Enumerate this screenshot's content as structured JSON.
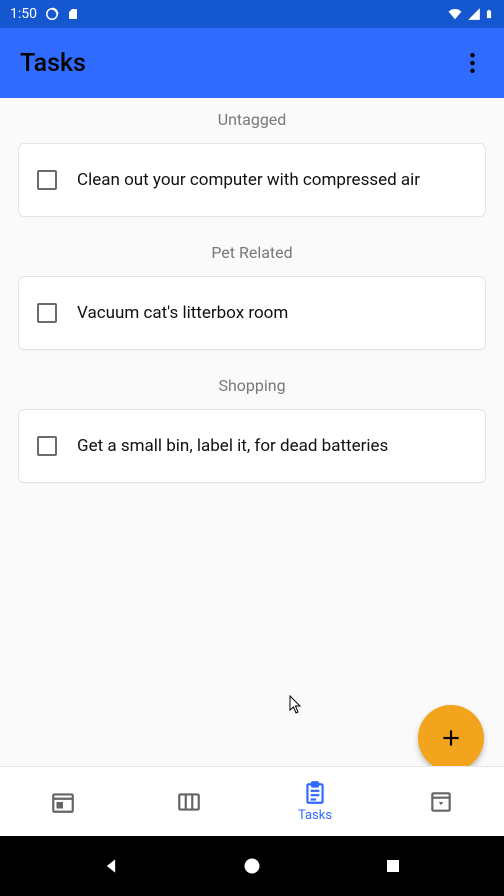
{
  "status": {
    "time": "1:50"
  },
  "app_bar": {
    "title": "Tasks"
  },
  "sections": [
    {
      "header": "Untagged",
      "tasks": [
        {
          "text": "Clean out your computer with compressed air",
          "checked": false
        }
      ]
    },
    {
      "header": "Pet Related",
      "tasks": [
        {
          "text": "Vacuum cat's litterbox room",
          "checked": false
        }
      ]
    },
    {
      "header": "Shopping",
      "tasks": [
        {
          "text": "Get a small bin, label it, for dead batteries",
          "checked": false
        }
      ]
    }
  ],
  "bottom_nav": {
    "items": [
      {
        "label": "",
        "active": false
      },
      {
        "label": "",
        "active": false
      },
      {
        "label": "Tasks",
        "active": true
      },
      {
        "label": "",
        "active": false
      }
    ]
  }
}
